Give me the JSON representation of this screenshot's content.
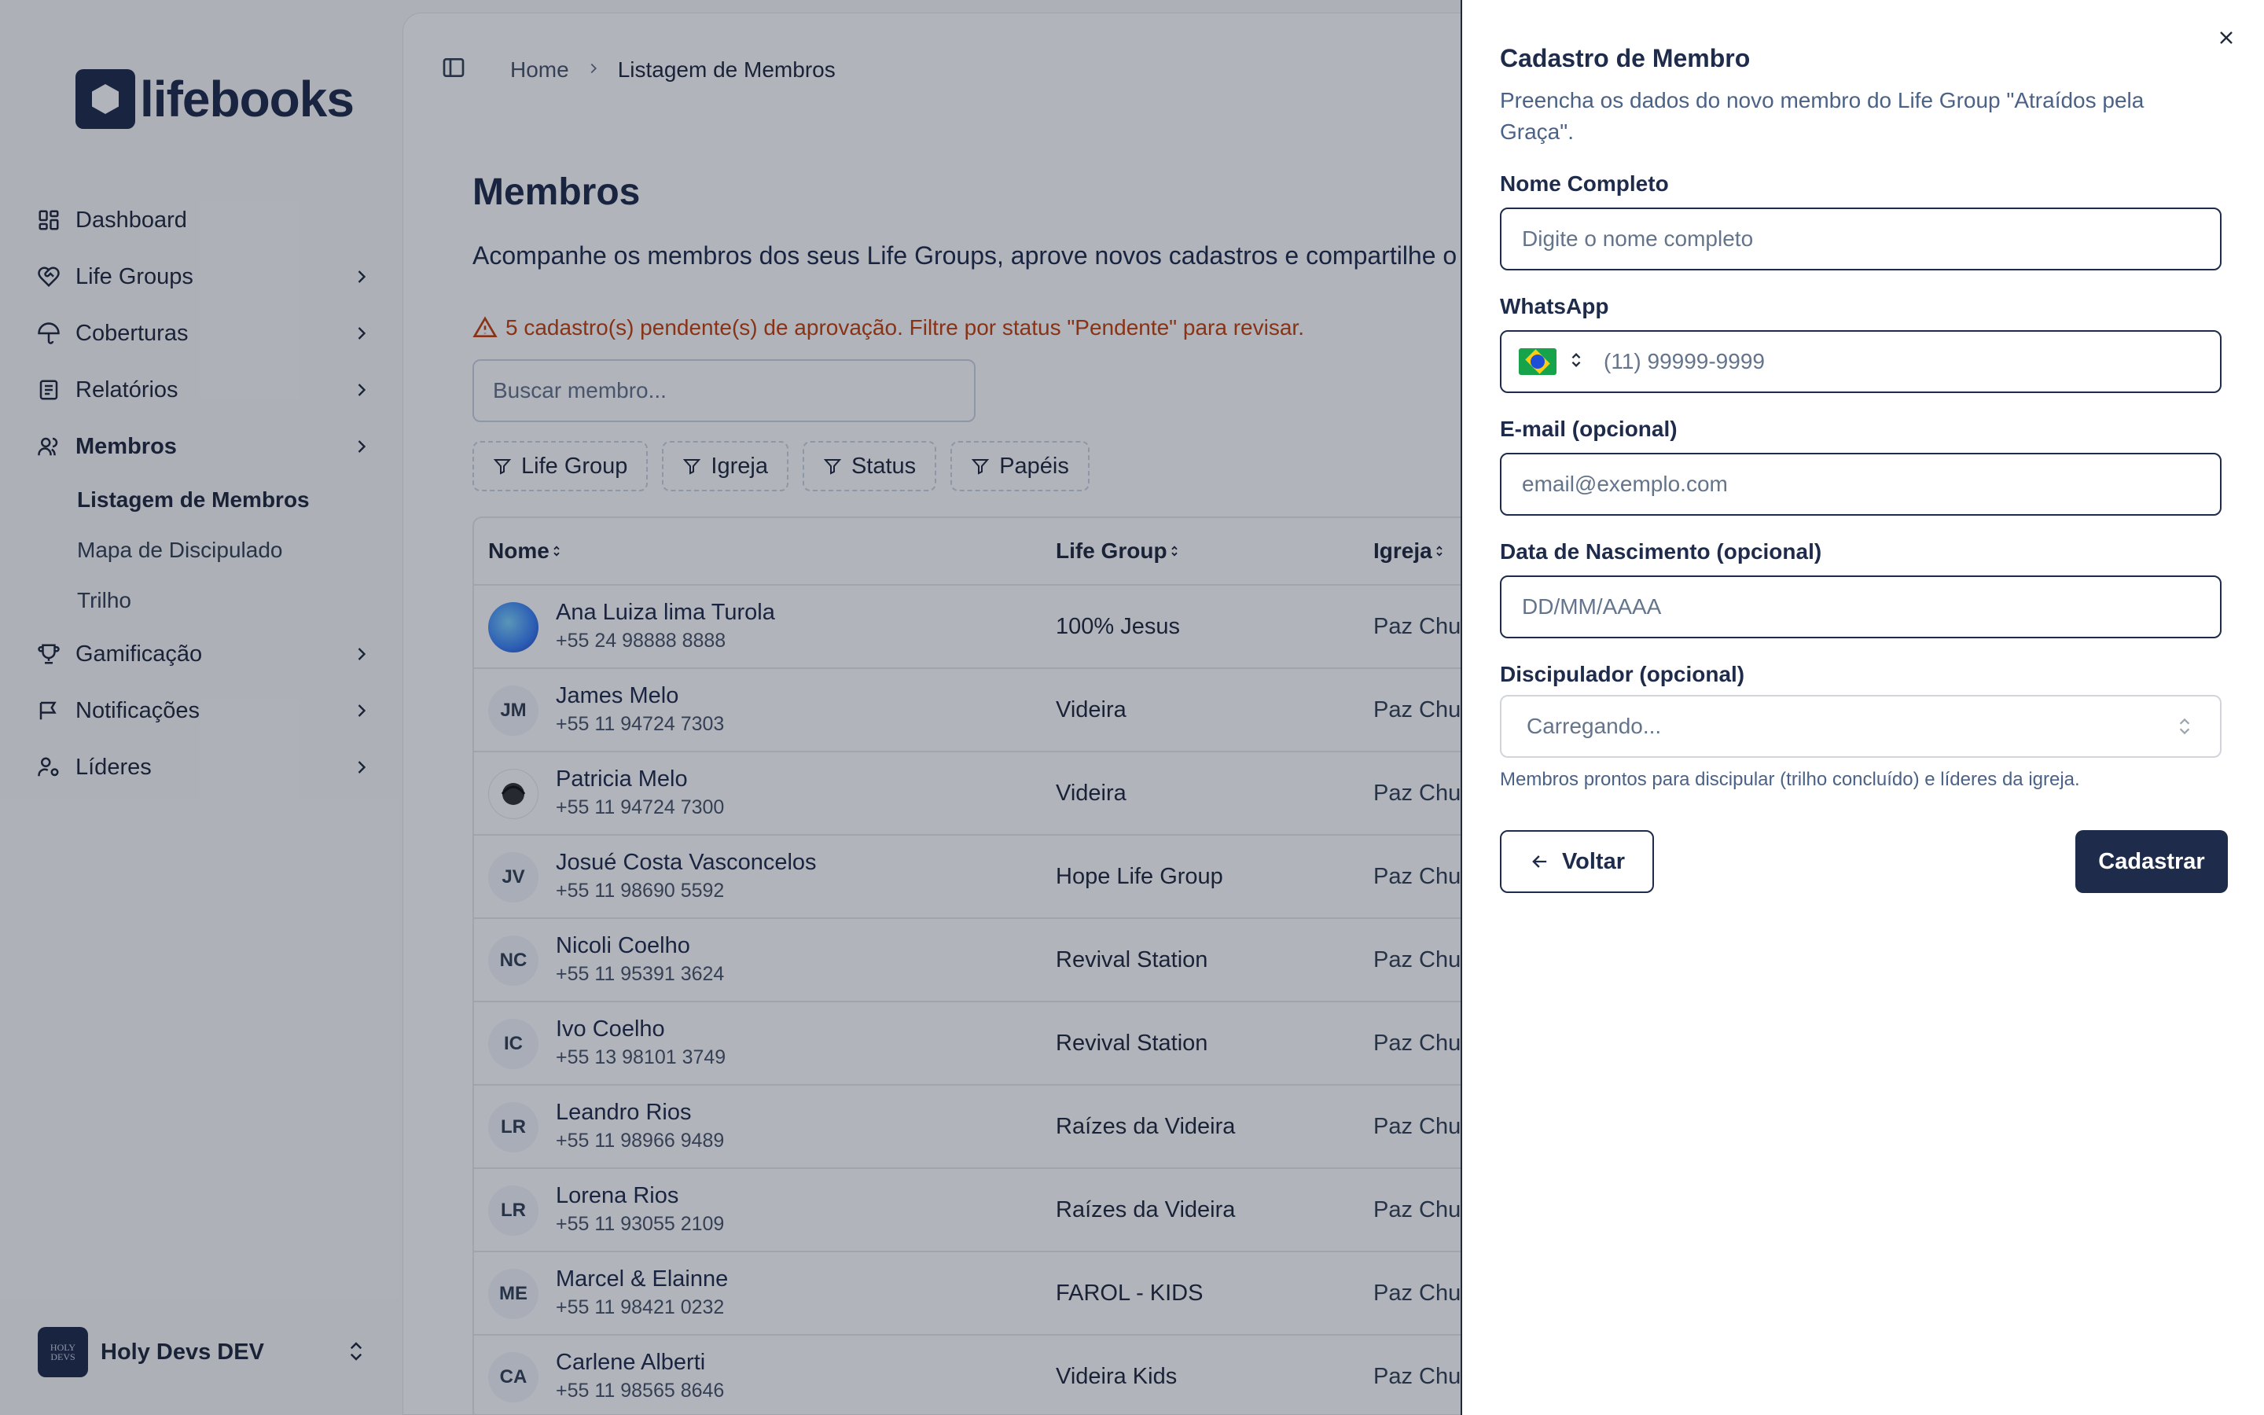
{
  "brand": {
    "name": "lifebooks"
  },
  "sidebar": {
    "items": [
      {
        "label": "Dashboard",
        "icon": "dashboard-icon"
      },
      {
        "label": "Life Groups",
        "icon": "heart-handshake-icon"
      },
      {
        "label": "Coberturas",
        "icon": "umbrella-icon"
      },
      {
        "label": "Relatórios",
        "icon": "report-icon"
      },
      {
        "label": "Membros",
        "icon": "users-icon"
      },
      {
        "label": "Gamificação",
        "icon": "trophy-icon"
      },
      {
        "label": "Notificações",
        "icon": "flag-message-icon"
      },
      {
        "label": "Líderes",
        "icon": "user-cog-icon"
      }
    ],
    "sub_items": [
      {
        "label": "Listagem de Membros"
      },
      {
        "label": "Mapa de Discipulado"
      },
      {
        "label": "Trilho"
      }
    ],
    "org": {
      "name": "Holy Devs DEV",
      "logo_text": "HOLY DEVS"
    }
  },
  "breadcrumb": {
    "home": "Home",
    "current": "Listagem de Membros"
  },
  "page": {
    "title": "Membros",
    "description": "Acompanhe os membros dos seus Life Groups, aprove novos cadastros e compartilhe o",
    "alert": "5 cadastro(s) pendente(s) de aprovação. Filtre por status \"Pendente\" para revisar.",
    "search_placeholder": "Buscar membro...",
    "filters": [
      "Life Group",
      "Igreja",
      "Status",
      "Papéis"
    ]
  },
  "table": {
    "headers": {
      "name": "Nome",
      "group": "Life Group",
      "church": "Igreja"
    },
    "rows": [
      {
        "initials": "",
        "name": "Ana Luiza lima Turola",
        "phone": "+55 24 98888 8888",
        "group": "100% Jesus",
        "church": "Paz Chu"
      },
      {
        "initials": "JM",
        "name": "James Melo",
        "phone": "+55 11 94724 7303",
        "group": "Videira",
        "church": "Paz Chu"
      },
      {
        "initials": "",
        "name": "Patricia Melo",
        "phone": "+55 11 94724 7300",
        "group": "Videira",
        "church": "Paz Chu"
      },
      {
        "initials": "JV",
        "name": "Josué Costa Vasconcelos",
        "phone": "+55 11 98690 5592",
        "group": "Hope Life Group",
        "church": "Paz Chu"
      },
      {
        "initials": "NC",
        "name": "Nicoli Coelho",
        "phone": "+55 11 95391 3624",
        "group": "Revival Station",
        "church": "Paz Chu"
      },
      {
        "initials": "IC",
        "name": "Ivo Coelho",
        "phone": "+55 13 98101 3749",
        "group": "Revival Station",
        "church": "Paz Chu"
      },
      {
        "initials": "LR",
        "name": "Leandro Rios",
        "phone": "+55 11 98966 9489",
        "group": "Raízes da Videira",
        "church": "Paz Chu"
      },
      {
        "initials": "LR",
        "name": "Lorena Rios",
        "phone": "+55 11 93055 2109",
        "group": "Raízes da Videira",
        "church": "Paz Chu"
      },
      {
        "initials": "ME",
        "name": "Marcel & Elainne",
        "phone": "+55 11 98421 0232",
        "group": "FAROL - KIDS",
        "church": "Paz Chu"
      },
      {
        "initials": "CA",
        "name": "Carlene Alberti",
        "phone": "+55 11 98565 8646",
        "group": "Videira Kids",
        "church": "Paz Chu"
      }
    ]
  },
  "drawer": {
    "title": "Cadastro de Membro",
    "description": "Preencha os dados do novo membro do Life Group \"Atraídos pela Graça\".",
    "fields": {
      "name": {
        "label": "Nome Completo",
        "placeholder": "Digite o nome completo"
      },
      "whatsapp": {
        "label": "WhatsApp",
        "placeholder": "(11) 99999-9999"
      },
      "email": {
        "label": "E-mail (opcional)",
        "placeholder": "email@exemplo.com"
      },
      "birth": {
        "label": "Data de Nascimento (opcional)",
        "placeholder": "DD/MM/AAAA"
      },
      "discipler": {
        "label": "Discipulador (opcional)",
        "value": "Carregando...",
        "hint": "Membros prontos para discipular (trilho concluído) e líderes da igreja."
      }
    },
    "back_label": "Voltar",
    "submit_label": "Cadastrar"
  },
  "colors": {
    "primary": "#1e2b4a",
    "warning": "#c2410c",
    "muted": "#4b6287"
  }
}
